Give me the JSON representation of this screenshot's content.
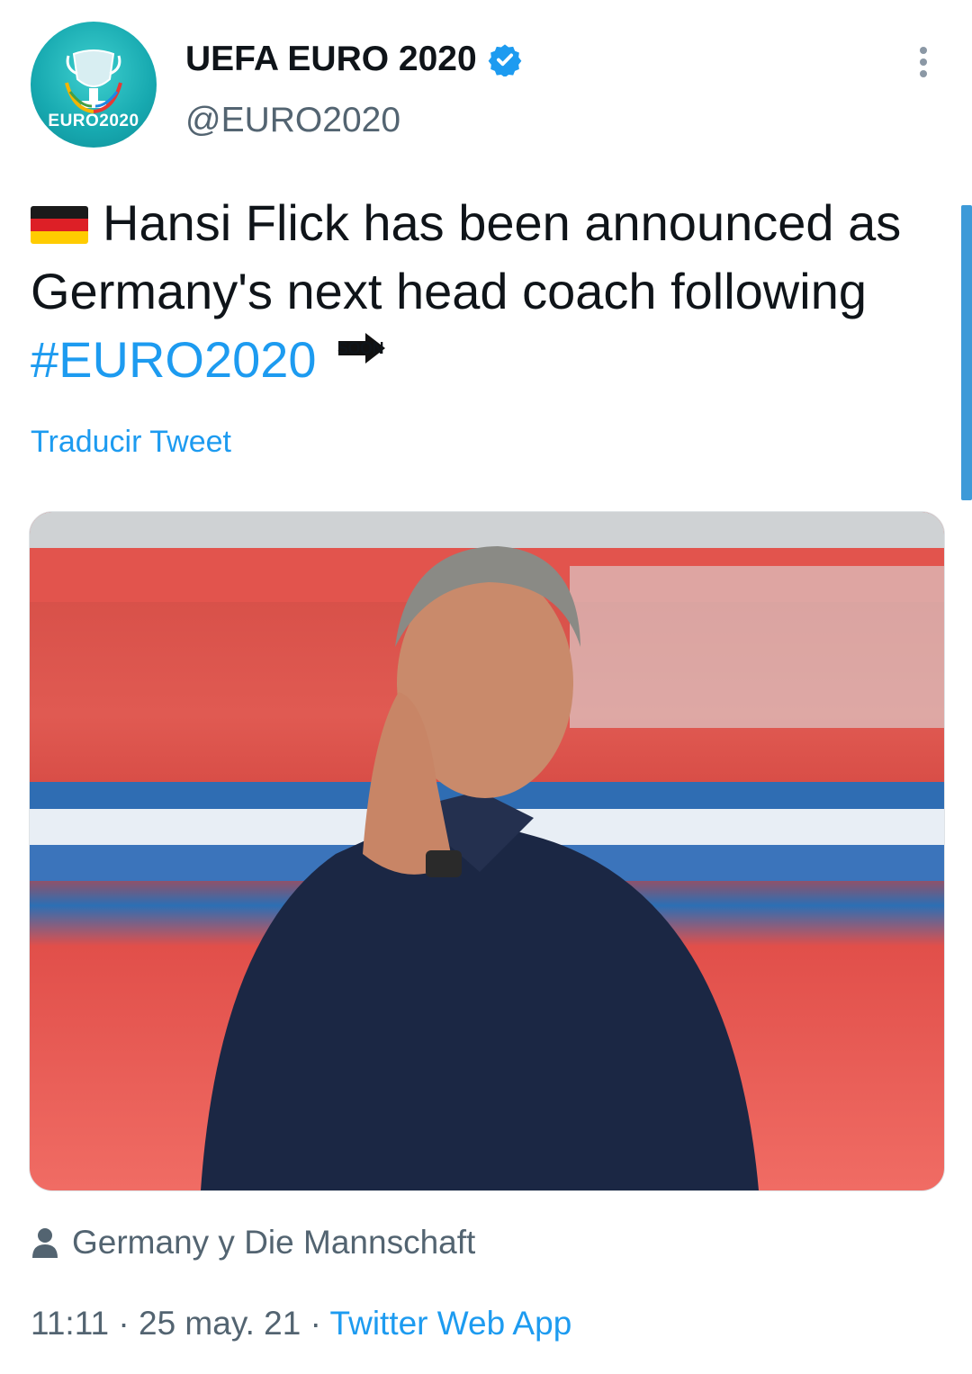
{
  "tweet": {
    "author": {
      "display_name": "UEFA EURO 2020",
      "handle": "@EURO2020",
      "avatar_text": "EURO2020",
      "verified": true,
      "avatar_icon": "euro2020-logo-icon"
    },
    "text_part1": "Hansi Flick has been announced as Germany's next head coach following",
    "hashtag": "#EURO2020",
    "soon_label": "SOON",
    "translate_label": "Traducir Tweet",
    "tagged_label": "Germany y Die Mannschaft",
    "time": "11:11",
    "date": "25 may. 21",
    "separator": "·",
    "source": "Twitter Web App"
  },
  "colors": {
    "link": "#1d9bf0",
    "secondary_text": "#536471",
    "avatar_bg": "#17a9b0"
  },
  "icons": [
    "germany-flag-icon",
    "soon-arrow-icon",
    "verified-badge-icon",
    "more-options-icon",
    "person-icon"
  ]
}
